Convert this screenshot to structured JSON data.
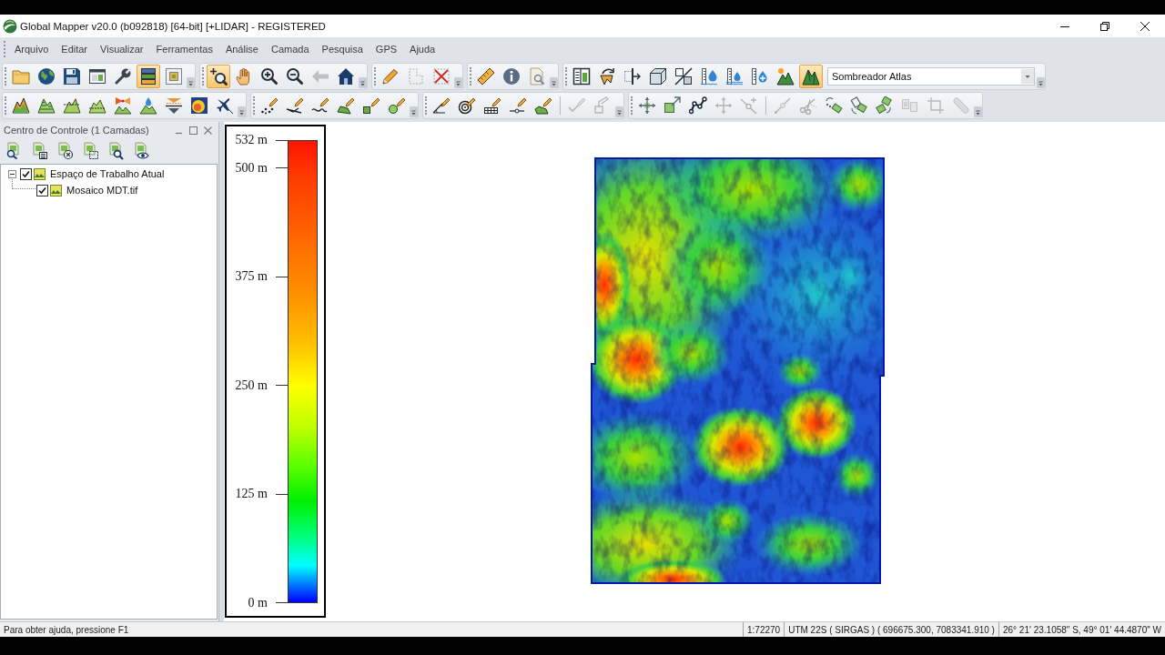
{
  "window": {
    "title": "Global Mapper v20.0 (b092818) [64-bit] [+LIDAR] - REGISTERED"
  },
  "menu": {
    "items": [
      "Arquivo",
      "Editar",
      "Visualizar",
      "Ferramentas",
      "Análise",
      "Camada",
      "Pesquisa",
      "GPS",
      "Ajuda"
    ]
  },
  "toolbars": [
    {
      "groups": [
        {
          "buttons": [
            {
              "selected": false,
              "disabled": false
            },
            {
              "selected": false,
              "disabled": false
            },
            {
              "selected": false,
              "disabled": false
            },
            {
              "selected": false,
              "disabled": false
            },
            {
              "selected": false,
              "disabled": false
            },
            {
              "selected": true,
              "disabled": false
            },
            {
              "selected": false,
              "disabled": false
            }
          ]
        },
        {
          "buttons": [
            {
              "selected": true,
              "disabled": false
            },
            {
              "selected": false,
              "disabled": false
            },
            {
              "selected": false,
              "disabled": false
            },
            {
              "selected": false,
              "disabled": false
            },
            {
              "selected": false,
              "disabled": true
            },
            {
              "selected": false,
              "disabled": false
            }
          ]
        },
        {
          "buttons": [
            {
              "selected": false,
              "disabled": false
            },
            {
              "selected": false,
              "disabled": true
            },
            {
              "selected": false,
              "disabled": false
            }
          ]
        },
        {
          "buttons": [
            {
              "selected": false,
              "disabled": false
            },
            {
              "selected": false,
              "disabled": false
            },
            {
              "selected": false,
              "disabled": false
            }
          ]
        },
        {
          "buttons": [
            {
              "selected": false,
              "disabled": false
            },
            {
              "selected": false,
              "disabled": false
            },
            {
              "selected": false,
              "disabled": false
            },
            {
              "selected": false,
              "disabled": false
            },
            {
              "selected": false,
              "disabled": false
            },
            {
              "selected": false,
              "disabled": false
            },
            {
              "selected": false,
              "disabled": false
            },
            {
              "selected": false,
              "disabled": false
            },
            {
              "selected": false,
              "disabled": false
            },
            {
              "selected": true,
              "disabled": false
            }
          ],
          "dropdown": {
            "value": "Sombreador Atlas"
          }
        }
      ]
    },
    {
      "groups": [
        {
          "buttons": [
            {
              "selected": false,
              "disabled": false
            },
            {
              "selected": false,
              "disabled": false
            },
            {
              "selected": false,
              "disabled": false
            },
            {
              "selected": false,
              "disabled": false
            },
            {
              "selected": false,
              "disabled": false
            },
            {
              "selected": false,
              "disabled": false
            },
            {
              "selected": false,
              "disabled": false
            },
            {
              "selected": false,
              "disabled": false
            },
            {
              "selected": false,
              "disabled": false
            }
          ]
        },
        {
          "buttons": [
            {
              "selected": false,
              "disabled": false
            },
            {
              "selected": false,
              "disabled": false
            },
            {
              "selected": false,
              "disabled": false
            },
            {
              "selected": false,
              "disabled": false
            },
            {
              "selected": false,
              "disabled": false
            },
            {
              "selected": false,
              "disabled": false
            }
          ]
        },
        {
          "buttons": [
            {
              "selected": false,
              "disabled": false
            },
            {
              "selected": false,
              "disabled": false
            },
            {
              "selected": false,
              "disabled": false
            },
            {
              "selected": false,
              "disabled": false
            },
            {
              "selected": false,
              "disabled": false
            },
            {
              "selected": false,
              "disabled": true
            },
            {
              "selected": false,
              "disabled": true
            }
          ]
        },
        {
          "buttons": [
            {
              "selected": false,
              "disabled": false
            },
            {
              "selected": false,
              "disabled": false
            },
            {
              "selected": false,
              "disabled": false
            },
            {
              "selected": false,
              "disabled": true
            },
            {
              "selected": false,
              "disabled": true
            },
            {
              "selected": false,
              "disabled": true
            },
            {
              "selected": false,
              "disabled": true
            },
            {
              "selected": false,
              "disabled": false
            },
            {
              "selected": false,
              "disabled": false
            },
            {
              "selected": false,
              "disabled": false
            },
            {
              "selected": false,
              "disabled": true
            },
            {
              "selected": false,
              "disabled": true
            },
            {
              "selected": false,
              "disabled": true
            }
          ]
        }
      ]
    }
  ],
  "control_center": {
    "title": "Centro de Controle (1 Camadas)",
    "layers": [
      {
        "label": "Espaço de Trabalho Atual",
        "checked": true,
        "expanded": true,
        "children": [
          {
            "label": "Mosaico MDT.tif",
            "checked": true
          }
        ]
      }
    ]
  },
  "legend": {
    "ticks": [
      "532 m",
      "500 m",
      "375 m",
      "250 m",
      "125 m",
      "0 m"
    ]
  },
  "status_bar": {
    "help": "Para obter ajuda, pressione F1",
    "scale": "1:72270",
    "projection": "UTM 22S ( SIRGAS ) ( 696675.300, 7083341.910 )",
    "coordinates": "26° 21' 23.1058\" S, 49° 01' 44.4870\" W"
  }
}
